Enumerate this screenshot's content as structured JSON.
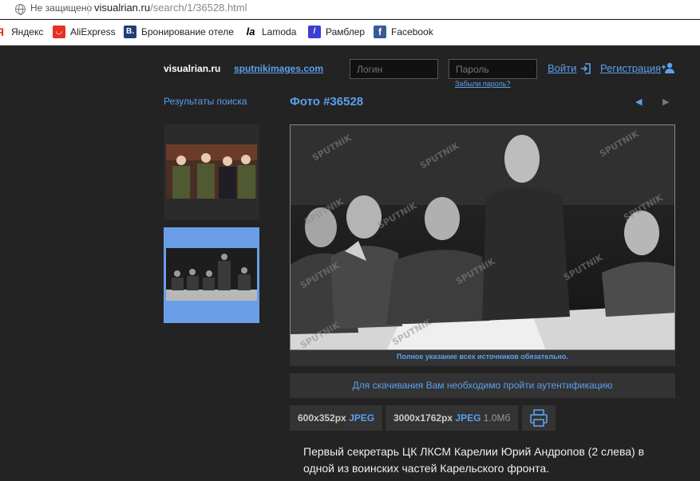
{
  "browser": {
    "security_label": "Не защищено",
    "url_host": "visualrian.ru",
    "url_path": "/search/1/36528.html",
    "bookmarks": [
      {
        "label": "Яндекс",
        "icon": "yandex-icon",
        "color": "#e0341f"
      },
      {
        "label": "AliExpress",
        "icon": "aliexpress-icon",
        "color": "#e43225"
      },
      {
        "label": "Бронирование отеле",
        "icon": "booking-icon",
        "color": "#1f3f7a"
      },
      {
        "label": "Lamoda",
        "icon": "lamoda-icon",
        "color": "#000000"
      },
      {
        "label": "Рамблер",
        "icon": "rambler-icon",
        "color": "#3a3fd4"
      },
      {
        "label": "Facebook",
        "icon": "facebook-icon",
        "color": "#3b5998"
      }
    ]
  },
  "header": {
    "logo": "visualrian.ru",
    "logo_link": "sputnikimages.com",
    "login_placeholder": "Логин",
    "password_placeholder": "Пароль",
    "forgot_password": "Забыли пароль?",
    "login_button": "Войти",
    "register_link": "Регистрация"
  },
  "sidebar": {
    "results_link": "Результаты поиска"
  },
  "photo": {
    "title": "Фото #36528",
    "credit_notice": "Полное указание всех источников обязательно.",
    "auth_notice": "Для скачивания Вам необходимо пройти аутентификацию",
    "sizes": [
      {
        "dims": "600x352px",
        "format": "JPEG",
        "filesize": ""
      },
      {
        "dims": "3000x1762px",
        "format": "JPEG",
        "filesize": "1.0Мб"
      }
    ],
    "caption": "Первый секретарь ЦК ЛКСМ Карелии Юрий Андропов (2 слева) в одной из воинских частей Карельского фронта.",
    "watermark": "SPUTNIK"
  },
  "colors": {
    "accent": "#5aa0ee",
    "background": "#232323",
    "panel": "#333333",
    "selected_thumb": "#6a9ee6"
  }
}
